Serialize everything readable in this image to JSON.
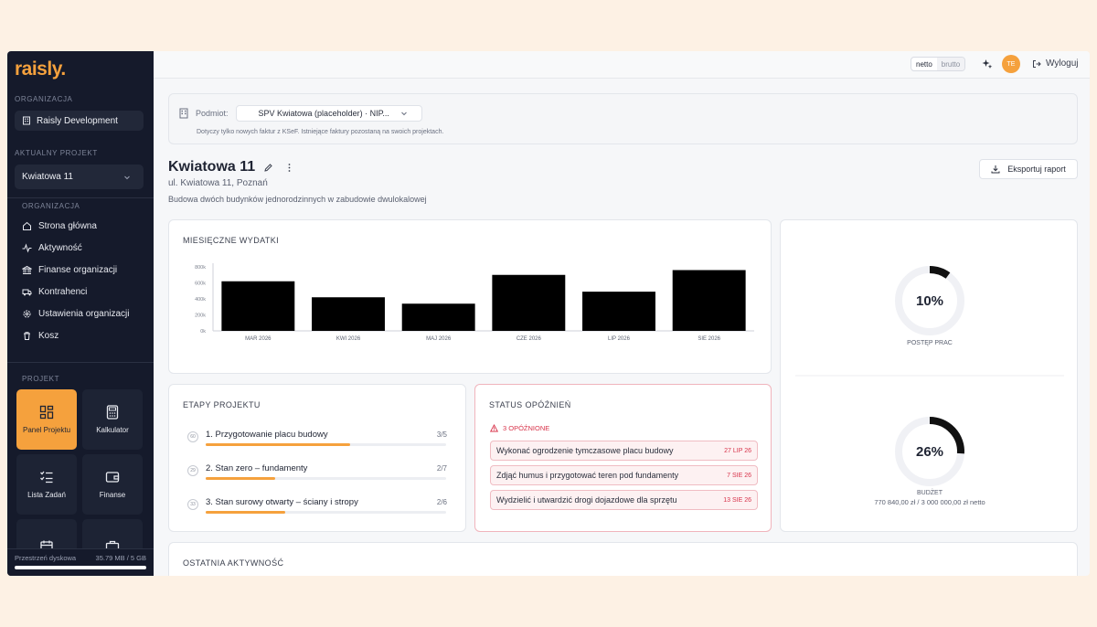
{
  "brand": {
    "logo": "raisly.",
    "accent": "#f5a13d",
    "sidebar_bg": "#151a2b"
  },
  "sidebar": {
    "org_label": "ORGANIZACJA",
    "org_name": "Raisly Development",
    "current_project_label": "AKTUALNY PROJEKT",
    "current_project": "Kwiatowa 11",
    "org_nav_label": "ORGANIZACJA",
    "org_nav": [
      {
        "label": "Strona główna",
        "icon": "home-icon"
      },
      {
        "label": "Aktywność",
        "icon": "activity-icon"
      },
      {
        "label": "Finanse organizacji",
        "icon": "bank-icon"
      },
      {
        "label": "Kontrahenci",
        "icon": "truck-icon"
      },
      {
        "label": "Ustawienia organizacji",
        "icon": "gear-icon"
      },
      {
        "label": "Kosz",
        "icon": "trash-icon"
      }
    ],
    "project_label": "PROJEKT",
    "tiles": [
      {
        "label": "Panel Projektu",
        "icon": "dashboard-icon",
        "active": true
      },
      {
        "label": "Kalkulator",
        "icon": "calculator-icon",
        "active": false
      },
      {
        "label": "Lista Zadań",
        "icon": "tasklist-icon",
        "active": false
      },
      {
        "label": "Finanse",
        "icon": "wallet-icon",
        "active": false
      },
      {
        "label": "",
        "icon": "calendar-icon",
        "active": false
      },
      {
        "label": "",
        "icon": "briefcase-icon",
        "active": false
      }
    ],
    "disk": {
      "label": "Przestrzeń dyskowa",
      "value": "35.79 MB / 5 GB"
    }
  },
  "topbar": {
    "toggle_on": "netto",
    "toggle_off": "brutto",
    "avatar": "TE",
    "logout": "Wyloguj"
  },
  "entity": {
    "label": "Podmiot:",
    "value": "SPV Kwiatowa (placeholder) · NIP...",
    "note": "Dotyczy tylko nowych faktur z KSeF. Istniejące faktury pozostaną na swoich projektach."
  },
  "project": {
    "title": "Kwiatowa 11",
    "address": "ul. Kwiatowa 11, Poznań",
    "description": "Budowa dwóch budynków jednorodzinnych w zabudowie dwulokalowej",
    "export": "Eksportuj raport"
  },
  "expenses": {
    "title": "MIESIĘCZNE WYDATKI"
  },
  "chart_data": {
    "type": "bar",
    "categories": [
      "MAR 2026",
      "KWI 2026",
      "MAJ 2026",
      "CZE 2026",
      "LIP 2026",
      "SIE 2026"
    ],
    "values": [
      620000,
      420000,
      340000,
      700000,
      490000,
      760000
    ],
    "yticks": [
      "800k",
      "600k",
      "400k",
      "200k",
      "0k"
    ],
    "ylim": [
      0,
      800000
    ],
    "bar_color": "#000000"
  },
  "progress": {
    "work_value": "10%",
    "work_fraction": 0.1,
    "work_label": "POSTĘP PRAC",
    "budget_value": "26%",
    "budget_fraction": 0.26,
    "budget_label": "BUDŻET",
    "budget_detail": "770 840,00 zł / 3 000 000,00 zł netto"
  },
  "stages": {
    "title": "ETAPY PROJEKTU",
    "items": [
      {
        "num": "60",
        "name": "1. Przygotowanie placu budowy",
        "count": "3/5",
        "fraction": 0.6
      },
      {
        "num": "29",
        "name": "2. Stan zero – fundamenty",
        "count": "2/7",
        "fraction": 0.29
      },
      {
        "num": "33",
        "name": "3. Stan surowy otwarty – ściany i stropy",
        "count": "2/6",
        "fraction": 0.33
      }
    ]
  },
  "delays": {
    "title": "STATUS OPÓŹNIEŃ",
    "count": "3 OPÓŹNIONE",
    "items": [
      {
        "name": "Wykonać ogrodzenie tymczasowe placu budowy",
        "date": "27 LIP 26"
      },
      {
        "name": "Zdjąć humus i przygotować teren pod fundamenty",
        "date": "7 SIE 26"
      },
      {
        "name": "Wydzielić i utwardzić drogi dojazdowe dla sprzętu",
        "date": "13 SIE 26"
      }
    ]
  },
  "activity": {
    "title": "OSTATNIA AKTYWNOŚĆ"
  }
}
